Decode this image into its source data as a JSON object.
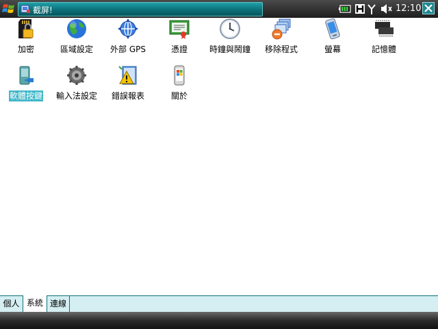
{
  "titlebar": {
    "title": "截屏!",
    "clock": "12:10",
    "icons": [
      "windows-start-icon",
      "app-icon",
      "battery-icon",
      "h-network-icon",
      "antenna-icon",
      "speaker-icon",
      "close-icon"
    ]
  },
  "items": [
    {
      "label": "加密",
      "icon": "lock-card-icon"
    },
    {
      "label": "區域設定",
      "icon": "globe-icon"
    },
    {
      "label": "外部 GPS",
      "icon": "gps-icon"
    },
    {
      "label": "憑證",
      "icon": "certificate-icon"
    },
    {
      "label": "時鐘與鬧鐘",
      "icon": "clock-icon"
    },
    {
      "label": "移除程式",
      "icon": "remove-programs-icon"
    },
    {
      "label": "螢幕",
      "icon": "screen-icon"
    },
    {
      "label": "記憶體",
      "icon": "memory-chip-icon"
    },
    {
      "label": "軟體按鍵",
      "icon": "soft-keys-icon",
      "selected": true
    },
    {
      "label": "輸入法設定",
      "icon": "input-gear-icon"
    },
    {
      "label": "錯誤報表",
      "icon": "error-report-icon"
    },
    {
      "label": "關於",
      "icon": "about-phone-icon"
    }
  ],
  "tabs": [
    {
      "label": "個人"
    },
    {
      "label": "系統",
      "active": true
    },
    {
      "label": "連線"
    }
  ],
  "colors": {
    "title_accent": "#0c6f78",
    "selection": "#3fb7c9",
    "tab_background": "#d4eef2"
  }
}
